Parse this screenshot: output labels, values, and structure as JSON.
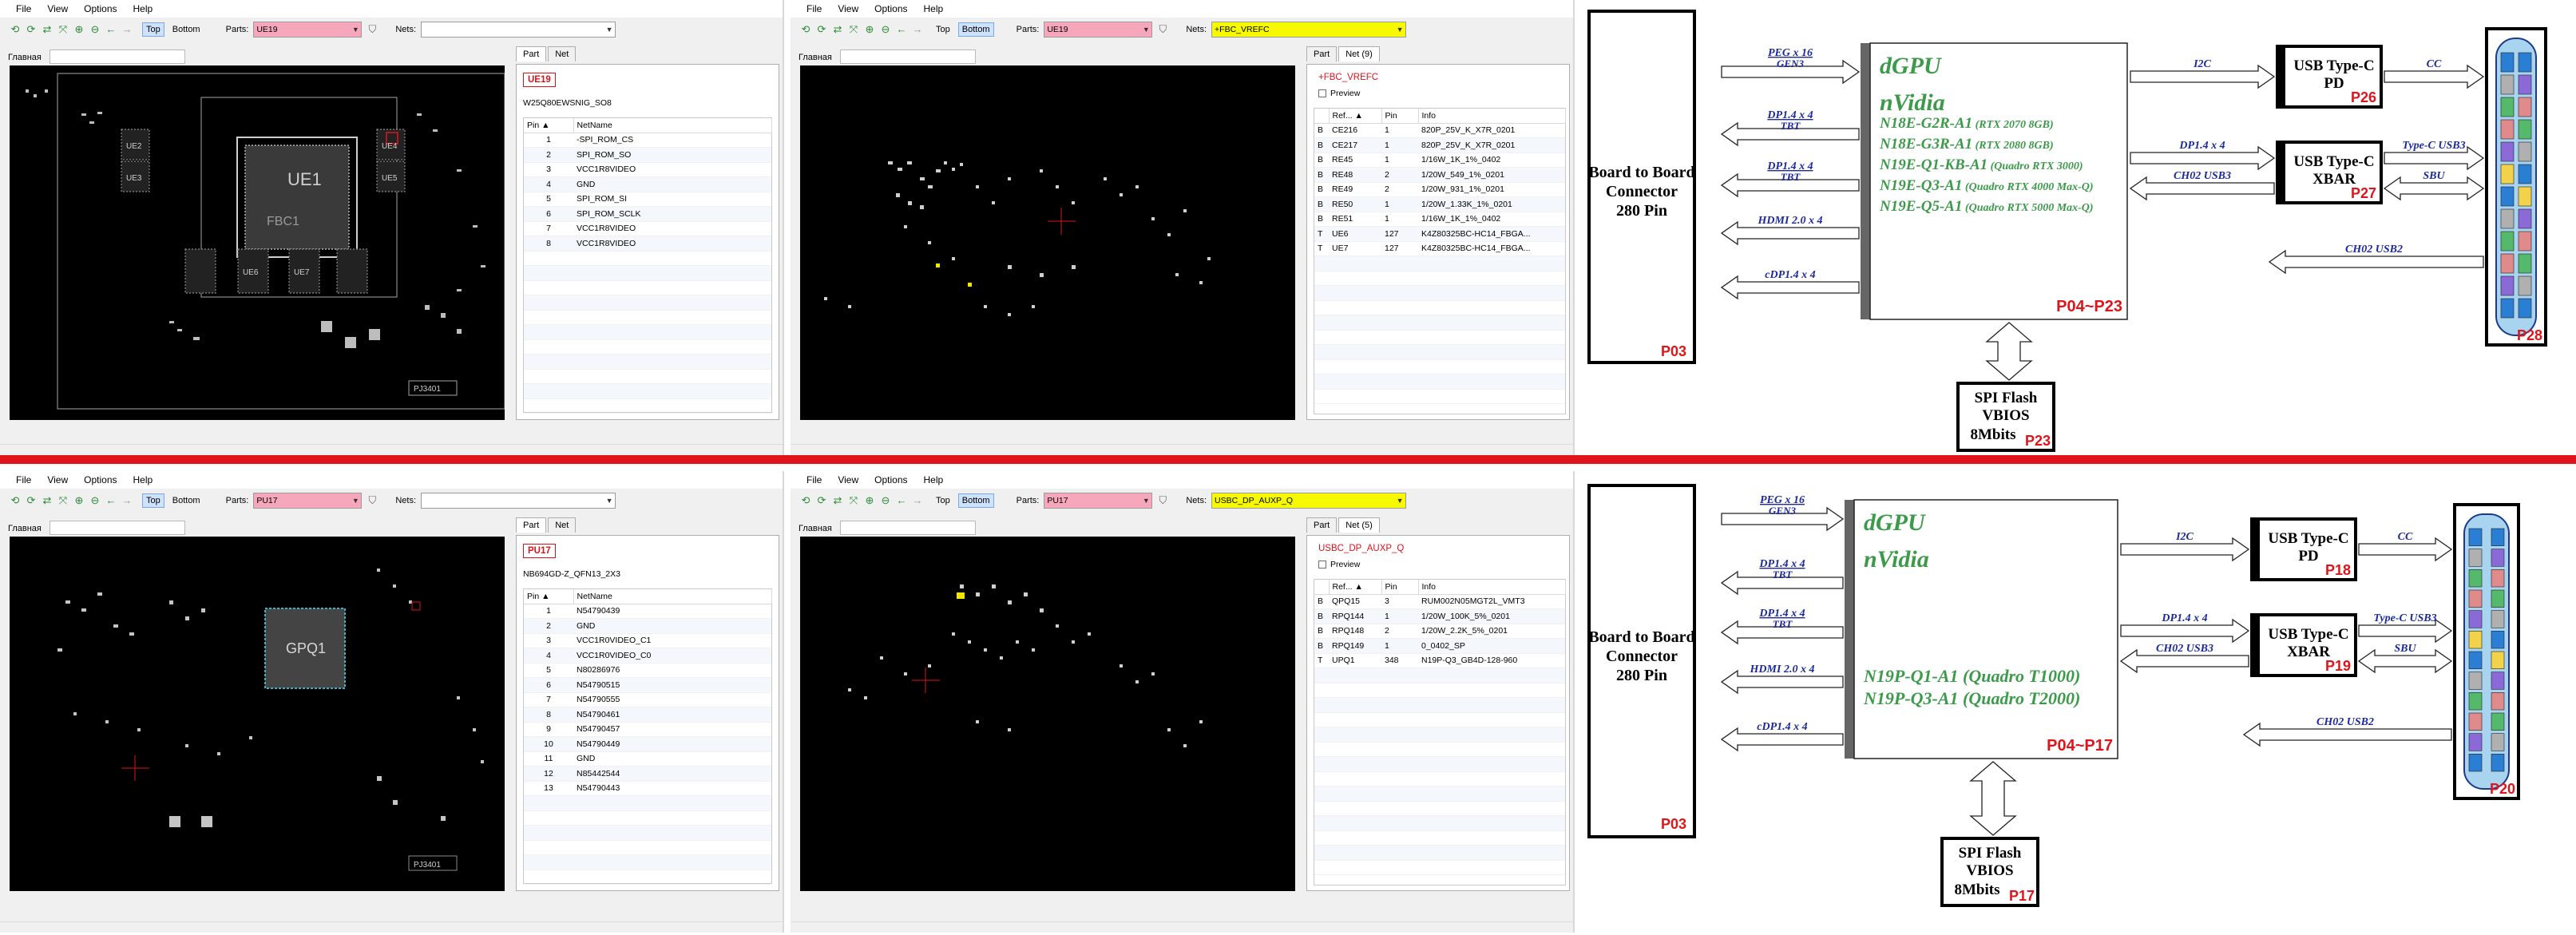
{
  "menu": [
    "File",
    "View",
    "Options",
    "Help"
  ],
  "toolbar": {
    "top": "Top",
    "bottom": "Bottom",
    "parts_label": "Parts:",
    "nets_label": "Nets:",
    "home_tab": "Главная"
  },
  "top": {
    "w1": {
      "parts": "UE19",
      "nets": "",
      "tabs": [
        "Part",
        "Net"
      ],
      "part_name": "UE19",
      "part_desc": "W25Q80EWSNIG_SO8",
      "pin_header": [
        "Pin",
        "NetName"
      ],
      "pins": [
        [
          "1",
          "-SPI_ROM_CS"
        ],
        [
          "2",
          "SPI_ROM_SO"
        ],
        [
          "3",
          "VCC1R8VIDEO"
        ],
        [
          "4",
          "GND"
        ],
        [
          "5",
          "SPI_ROM_SI"
        ],
        [
          "6",
          "SPI_ROM_SCLK"
        ],
        [
          "7",
          "VCC1R8VIDEO"
        ],
        [
          "8",
          "VCC1R8VIDEO"
        ]
      ],
      "board_labels": [
        "UE1",
        "FBC1",
        "UE2",
        "UE3",
        "UE4",
        "UE5",
        "UE6",
        "UE7",
        "PJ3401"
      ]
    },
    "w2": {
      "parts": "UE19",
      "nets": "+FBC_VREFC",
      "tabs": [
        "Part",
        "Net (9)"
      ],
      "net_name": "+FBC_VREFC",
      "preview": "Preview",
      "header": [
        "",
        "Ref...",
        "Pin",
        "Info"
      ],
      "rows": [
        [
          "B",
          "CE216",
          "1",
          "820P_25V_K_X7R_0201"
        ],
        [
          "B",
          "CE217",
          "1",
          "820P_25V_K_X7R_0201"
        ],
        [
          "B",
          "RE45",
          "1",
          "1/16W_1K_1%_0402"
        ],
        [
          "B",
          "RE48",
          "2",
          "1/20W_549_1%_0201"
        ],
        [
          "B",
          "RE49",
          "2",
          "1/20W_931_1%_0201"
        ],
        [
          "B",
          "RE50",
          "1",
          "1/20W_1.33K_1%_0201"
        ],
        [
          "B",
          "RE51",
          "1",
          "1/16W_1K_1%_0402"
        ],
        [
          "T",
          "UE6",
          "127",
          "K4Z80325BC-HC14_FBGA..."
        ],
        [
          "T",
          "UE7",
          "127",
          "K4Z80325BC-HC14_FBGA..."
        ]
      ]
    },
    "schem": {
      "conn_a": "Board to Board",
      "conn_b": "Connector",
      "conn_c": "280 Pin",
      "conn_ref": "P03",
      "gpu_a": "dGPU",
      "gpu_b": "nVidia",
      "gpu_ref": "P04~P23",
      "links": [
        "PEG x 16",
        "GEN3",
        "DP1.4 x 4",
        "TBT",
        "DP1.4 x 4",
        "TBT",
        "HDMI 2.0 x 4",
        "cDP1.4 x 4"
      ],
      "models": [
        "N18E-G2R-A1",
        "(RTX 2070 8GB)",
        "N18E-G3R-A1",
        "(RTX 2080 8GB)",
        "N19E-Q1-KB-A1",
        "(Quadro RTX 3000)",
        "N19E-Q3-A1",
        "(Quadro RTX 4000 Max-Q)",
        "N19E-Q5-A1",
        "(Quadro RTX 5000 Max-Q)"
      ],
      "pd_a": "USB Type-C",
      "pd_b": "PD",
      "pd_ref": "P26",
      "xbar_a": "USB Type-C",
      "xbar_b": "XBAR",
      "xbar_ref": "P27",
      "sig": [
        "I2C",
        "CC",
        "DP1.4 x 4",
        "Type-C USB3",
        "CH02 USB3",
        "SBU",
        "CH02 USB2"
      ],
      "spi_a": "SPI Flash",
      "spi_b": "VBIOS",
      "spi_c": "8Mbits",
      "spi_ref": "P23",
      "usbc_ref": "P28"
    }
  },
  "bot": {
    "w1": {
      "parts": "PU17",
      "nets": "",
      "tabs": [
        "Part",
        "Net"
      ],
      "part_name": "PU17",
      "part_desc": "NB694GD-Z_QFN13_2X3",
      "pin_header": [
        "Pin",
        "NetName"
      ],
      "pins": [
        [
          "1",
          "N54790439"
        ],
        [
          "2",
          "GND"
        ],
        [
          "3",
          "VCC1R0VIDEO_C1"
        ],
        [
          "4",
          "VCC1R0VIDEO_C0"
        ],
        [
          "5",
          "N80286976"
        ],
        [
          "6",
          "N54790515"
        ],
        [
          "7",
          "N54790555"
        ],
        [
          "8",
          "N54790461"
        ],
        [
          "9",
          "N54790457"
        ],
        [
          "10",
          "N54790449"
        ],
        [
          "11",
          "GND"
        ],
        [
          "12",
          "N85442544"
        ],
        [
          "13",
          "N54790443"
        ]
      ],
      "board_labels": [
        "GPQ1",
        "PJ3401"
      ]
    },
    "w2": {
      "parts": "PU17",
      "nets": "USBC_DP_AUXP_Q",
      "tabs": [
        "Part",
        "Net (5)"
      ],
      "net_name": "USBC_DP_AUXP_Q",
      "preview": "Preview",
      "header": [
        "",
        "Ref...",
        "Pin",
        "Info"
      ],
      "rows": [
        [
          "B",
          "QPQ15",
          "3",
          "RUM002N05MGT2L_VMT3"
        ],
        [
          "B",
          "RPQ144",
          "1",
          "1/20W_100K_5%_0201"
        ],
        [
          "B",
          "RPQ148",
          "2",
          "1/20W_2.2K_5%_0201"
        ],
        [
          "B",
          "RPQ149",
          "1",
          "0_0402_SP"
        ],
        [
          "T",
          "UPQ1",
          "348",
          "N19P-Q3_GB4D-128-960"
        ]
      ]
    },
    "schem": {
      "conn_a": "Board to Board",
      "conn_b": "Connector",
      "conn_c": "280 Pin",
      "conn_ref": "P03",
      "gpu_a": "dGPU",
      "gpu_b": "nVidia",
      "gpu_ref": "P04~P17",
      "links": [
        "PEG x 16",
        "GEN3",
        "DP1.4 x 4",
        "TBT",
        "DP1.4 x 4",
        "TBT",
        "HDMI 2.0 x 4",
        "cDP1.4 x 4"
      ],
      "models": [
        "N19P-Q1-A1 (Quadro T1000)",
        "N19P-Q3-A1 (Quadro T2000)"
      ],
      "pd_a": "USB Type-C",
      "pd_b": "PD",
      "pd_ref": "P18",
      "xbar_a": "USB Type-C",
      "xbar_b": "XBAR",
      "xbar_ref": "P19",
      "sig": [
        "I2C",
        "CC",
        "DP1.4 x 4",
        "Type-C USB3",
        "CH02 USB3",
        "SBU",
        "CH02 USB2"
      ],
      "spi_a": "SPI Flash",
      "spi_b": "VBIOS",
      "spi_c": "8Mbits",
      "spi_ref": "P17",
      "usbc_ref": "P20"
    }
  },
  "colors": {
    "accent_red": "#e0141b",
    "schem_green": "#3c9a4a",
    "schem_blue": "#1c2a9c",
    "pink_combo": "#f6a7bb",
    "yellow_combo": "#f7f900"
  }
}
